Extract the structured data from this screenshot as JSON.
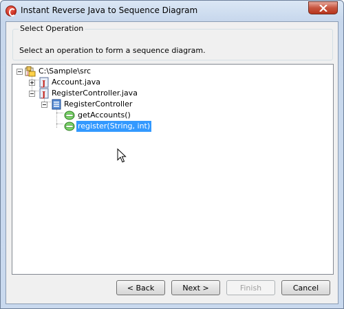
{
  "window": {
    "title": "Instant Reverse Java to Sequence Diagram"
  },
  "group": {
    "legend": "Select Operation",
    "description": "Select an operation to form a sequence diagram."
  },
  "tree": {
    "root": "C:\\Sample\\src",
    "file1": "Account.java",
    "file2": "RegisterController.java",
    "class": "RegisterController",
    "op1": "getAccounts()",
    "op2": "register(String, int)"
  },
  "buttons": {
    "back": "< Back",
    "next": "Next >",
    "finish": "Finish",
    "cancel": "Cancel"
  }
}
